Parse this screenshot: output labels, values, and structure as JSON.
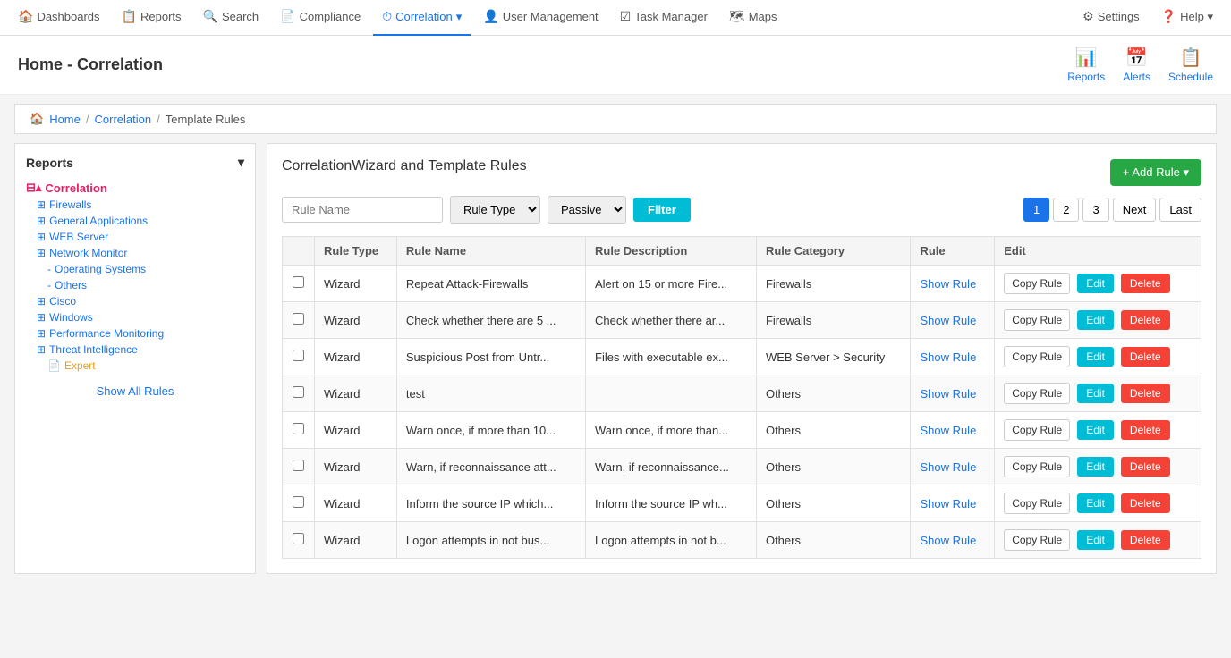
{
  "nav": {
    "items": [
      {
        "id": "dashboards",
        "label": "Dashboards",
        "icon": "🏠",
        "active": false
      },
      {
        "id": "reports",
        "label": "Reports",
        "icon": "📋",
        "active": false
      },
      {
        "id": "search",
        "label": "Search",
        "icon": "🔍",
        "active": false
      },
      {
        "id": "compliance",
        "label": "Compliance",
        "icon": "📄",
        "active": false
      },
      {
        "id": "correlation",
        "label": "Correlation",
        "icon": "⏱",
        "active": true
      },
      {
        "id": "user-management",
        "label": "User Management",
        "icon": "👤",
        "active": false
      },
      {
        "id": "task-manager",
        "label": "Task Manager",
        "icon": "☑",
        "active": false
      },
      {
        "id": "maps",
        "label": "Maps",
        "icon": "🗺",
        "active": false
      }
    ],
    "right": [
      {
        "id": "settings",
        "label": "Settings",
        "icon": "⚙"
      },
      {
        "id": "help",
        "label": "Help ▾",
        "icon": "❓"
      }
    ]
  },
  "header": {
    "title_bold": "Home",
    "title_rest": " - Correlation",
    "actions": [
      {
        "id": "reports",
        "label": "Reports",
        "icon": "📊"
      },
      {
        "id": "alerts",
        "label": "Alerts",
        "icon": "📅"
      },
      {
        "id": "schedule",
        "label": "Schedule",
        "icon": "📋"
      }
    ]
  },
  "breadcrumb": {
    "items": [
      "Home",
      "Correlation",
      "Template Rules"
    ]
  },
  "sidebar": {
    "header": "Reports",
    "tree": [
      {
        "label": "Correlation",
        "level": "root",
        "prefix": "⊟▴"
      },
      {
        "label": "Firewalls",
        "level": "level1",
        "prefix": "⊞"
      },
      {
        "label": "General Applications",
        "level": "level1",
        "prefix": "⊞"
      },
      {
        "label": "WEB Server",
        "level": "level1",
        "prefix": "⊞"
      },
      {
        "label": "Network Monitor",
        "level": "level1",
        "prefix": "⊞"
      },
      {
        "label": "Operating Systems",
        "level": "level2",
        "prefix": "-"
      },
      {
        "label": "Others",
        "level": "level2",
        "prefix": "-"
      },
      {
        "label": "Cisco",
        "level": "level1",
        "prefix": "⊞"
      },
      {
        "label": "Windows",
        "level": "level1",
        "prefix": "⊞"
      },
      {
        "label": "Performance Monitoring",
        "level": "level1",
        "prefix": "⊞"
      },
      {
        "label": "Threat Intelligence",
        "level": "level1",
        "prefix": "⊞"
      },
      {
        "label": "Expert",
        "level": "expert",
        "prefix": "📄"
      }
    ],
    "show_all_label": "Show All Rules"
  },
  "main": {
    "section_title": "CorrelationWizard and Template Rules",
    "add_rule_label": "+ Add Rule ▾",
    "filter": {
      "rule_name_placeholder": "Rule Name",
      "rule_type_label": "Rule Type",
      "passive_label": "Passive",
      "filter_btn_label": "Filter"
    },
    "pagination": {
      "pages": [
        "1",
        "2",
        "3",
        "Next",
        "Last"
      ]
    },
    "table": {
      "headers": [
        "",
        "Rule Type",
        "Rule Name",
        "Rule Description",
        "Rule Category",
        "Rule",
        "Edit"
      ],
      "rows": [
        {
          "rule_type": "Wizard",
          "rule_name": "Repeat Attack-Firewalls",
          "rule_description": "Alert on 15 or more Fire...",
          "rule_category": "Firewalls",
          "show_rule": "Show Rule",
          "copy_rule": "Copy Rule",
          "edit": "Edit",
          "delete": "Delete"
        },
        {
          "rule_type": "Wizard",
          "rule_name": "Check whether there are 5 ...",
          "rule_description": "Check whether there ar...",
          "rule_category": "Firewalls",
          "show_rule": "Show Rule",
          "copy_rule": "Copy Rule",
          "edit": "Edit",
          "delete": "Delete"
        },
        {
          "rule_type": "Wizard",
          "rule_name": "Suspicious Post from Untr...",
          "rule_description": "Files with executable ex...",
          "rule_category": "WEB Server > Security",
          "show_rule": "Show Rule",
          "copy_rule": "Copy Rule",
          "edit": "Edit",
          "delete": "Delete"
        },
        {
          "rule_type": "Wizard",
          "rule_name": "test",
          "rule_description": "",
          "rule_category": "Others",
          "show_rule": "Show Rule",
          "copy_rule": "Copy Rule",
          "edit": "Edit",
          "delete": "Delete"
        },
        {
          "rule_type": "Wizard",
          "rule_name": "Warn once, if more than 10...",
          "rule_description": "Warn once, if more than...",
          "rule_category": "Others",
          "show_rule": "Show Rule",
          "copy_rule": "Copy Rule",
          "edit": "Edit",
          "delete": "Delete"
        },
        {
          "rule_type": "Wizard",
          "rule_name": "Warn, if reconnaissance att...",
          "rule_description": "Warn, if reconnaissance...",
          "rule_category": "Others",
          "show_rule": "Show Rule",
          "copy_rule": "Copy Rule",
          "edit": "Edit",
          "delete": "Delete"
        },
        {
          "rule_type": "Wizard",
          "rule_name": "Inform the source IP which...",
          "rule_description": "Inform the source IP wh...",
          "rule_category": "Others",
          "show_rule": "Show Rule",
          "copy_rule": "Copy Rule",
          "edit": "Edit",
          "delete": "Delete"
        },
        {
          "rule_type": "Wizard",
          "rule_name": "Logon attempts in not bus...",
          "rule_description": "Logon attempts in not b...",
          "rule_category": "Others",
          "show_rule": "Show Rule",
          "copy_rule": "Copy Rule",
          "edit": "Edit",
          "delete": "Delete"
        }
      ]
    }
  }
}
